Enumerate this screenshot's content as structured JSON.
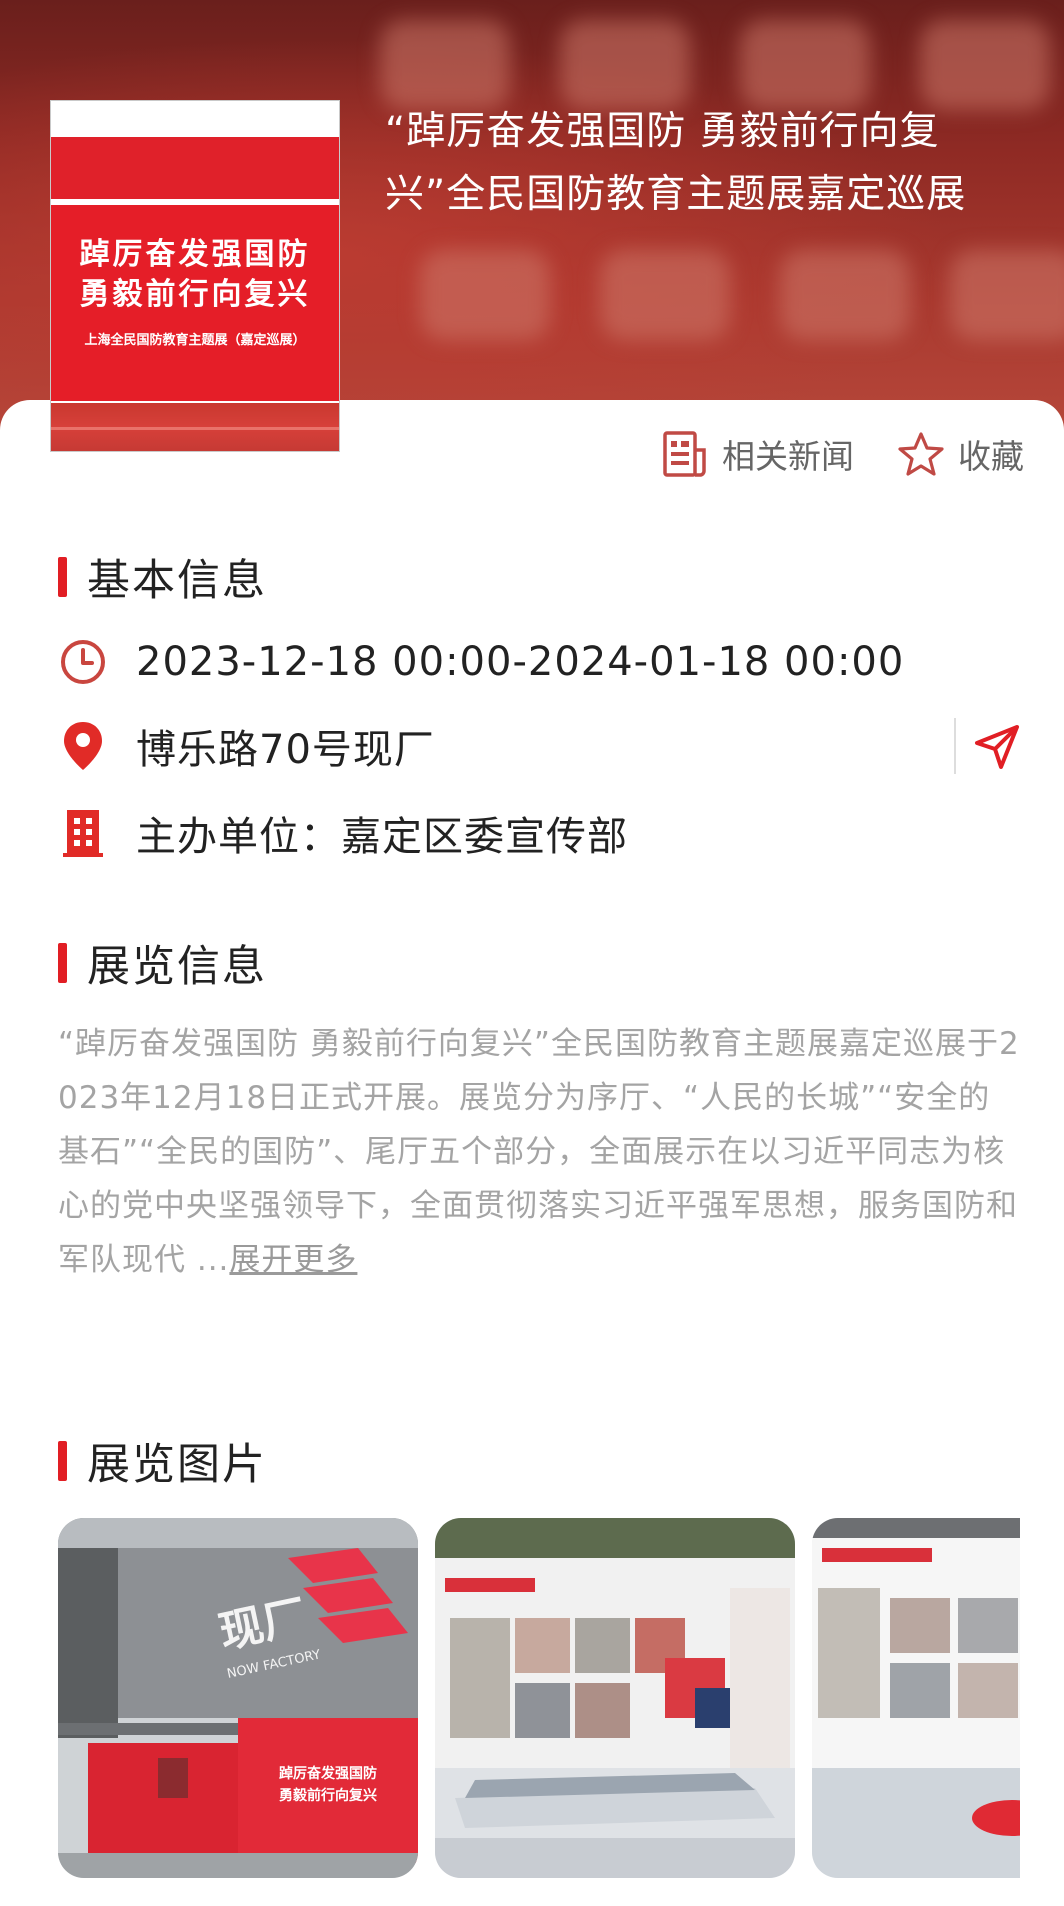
{
  "hero": {
    "title": "“踔厉奋发强国防 勇毅前行向复兴”全民国防教育主题展嘉定巡展",
    "poster": {
      "line1": "踔厉奋发强国防",
      "line2": "勇毅前行向复兴",
      "subtitle": "上海全民国防教育主题展（嘉定巡展）"
    }
  },
  "actions": {
    "news_label": "相关新闻",
    "favorite_label": "收藏"
  },
  "basic_info": {
    "title": "基本信息",
    "datetime": "2023-12-18 00:00-2024-01-18 00:00",
    "address": "博乐路70号现厂",
    "organizer": "主办单位：嘉定区委宣传部"
  },
  "exhibition_info": {
    "title": "展览信息",
    "description": "“踔厉奋发强国防 勇毅前行向复兴”全民国防教育主题展嘉定巡展于2023年12月18日正式开展。展览分为序厅、“人民的长城”“安全的基石”“全民的国防”、尾厅五个部分，全面展示在以习近平同志为核心的党中央坚强领导下，全面贯彻落实习近平强军思想，服务国防和军队现代 ...",
    "more_label": "展开更多"
  },
  "gallery": {
    "title": "展览图片",
    "photo1": {
      "sign": "现厂",
      "sign_en": "NOW FACTORY",
      "panel_line1": "踔厉奋发强国防",
      "panel_line2": "勇毅前行向复兴"
    }
  },
  "colors": {
    "accent": "#e11e24",
    "text": "#222222",
    "muted": "#a4a4a4"
  },
  "icons": {
    "news": "news-icon",
    "favorite": "star-icon",
    "time": "clock-icon",
    "location": "location-pin-icon",
    "organizer": "building-icon",
    "navigate": "navigation-arrow-icon"
  }
}
